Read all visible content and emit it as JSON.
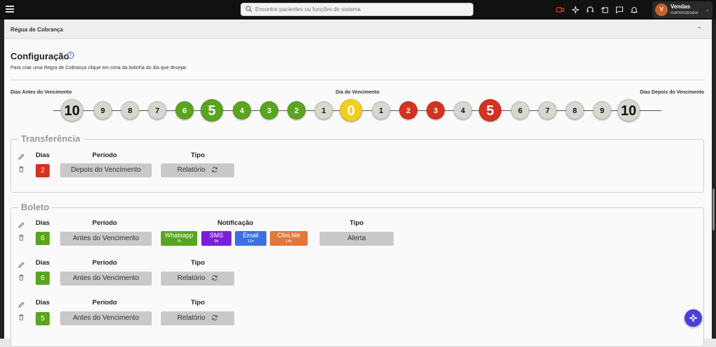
{
  "header": {
    "search_placeholder": "Encontre pacientes ou funções do sistema",
    "user_initial": "V",
    "user_name": "Vendas",
    "user_role": "Administrador"
  },
  "card": {
    "title": "Régua de Cobrança",
    "config_title": "Configuração",
    "config_desc": "Para criar uma Regra de Cobrança clique em cima da bolinha do dia que desejar.",
    "label_before": "Dias Antes do Vencimento",
    "label_due": "Dia do Vencimento",
    "label_after": "Dias Depois do Vencimento"
  },
  "timeline": [
    {
      "label": "10",
      "color": "gray",
      "size": "big"
    },
    {
      "label": "9",
      "color": "gray",
      "size": "small"
    },
    {
      "label": "8",
      "color": "gray",
      "size": "small"
    },
    {
      "label": "7",
      "color": "gray",
      "size": "small"
    },
    {
      "label": "6",
      "color": "green",
      "size": "small"
    },
    {
      "label": "5",
      "color": "green",
      "size": "big"
    },
    {
      "label": "4",
      "color": "green",
      "size": "small"
    },
    {
      "label": "3",
      "color": "green",
      "size": "small"
    },
    {
      "label": "2",
      "color": "green",
      "size": "small"
    },
    {
      "label": "1",
      "color": "gray",
      "size": "small"
    },
    {
      "label": "0",
      "color": "yellow",
      "size": "big"
    },
    {
      "label": "1",
      "color": "gray",
      "size": "small"
    },
    {
      "label": "2",
      "color": "red",
      "size": "small"
    },
    {
      "label": "3",
      "color": "red",
      "size": "small"
    },
    {
      "label": "4",
      "color": "gray",
      "size": "small"
    },
    {
      "label": "5",
      "color": "red",
      "size": "big"
    },
    {
      "label": "6",
      "color": "gray",
      "size": "small"
    },
    {
      "label": "7",
      "color": "gray",
      "size": "small"
    },
    {
      "label": "8",
      "color": "gray",
      "size": "small"
    },
    {
      "label": "9",
      "color": "gray",
      "size": "small"
    },
    {
      "label": "10",
      "color": "gray",
      "size": "big"
    }
  ],
  "transferencia": {
    "legend": "Transferência",
    "col_dias": "Dias",
    "col_periodo": "Período",
    "col_tipo": "Tipo",
    "dias": "2",
    "periodo": "Depois do Vencimento",
    "tipo": "Relatório"
  },
  "boleto": {
    "legend": "Boleto",
    "rows": [
      {
        "col_dias": "Dias",
        "col_periodo": "Período",
        "col_notificacao": "Notificação",
        "col_tipo": "Tipo",
        "dias": "6",
        "periodo": "Antes do Vencimento",
        "notifications": [
          {
            "name": "Whatsapp",
            "time": "7h"
          },
          {
            "name": "SMS",
            "time": "9h"
          },
          {
            "name": "Email",
            "time": "11h"
          },
          {
            "name": "Clini.Me",
            "time": "14h"
          }
        ],
        "tipo": "Alerta"
      },
      {
        "col_dias": "Dias",
        "col_periodo": "Período",
        "col_tipo": "Tipo",
        "dias": "6",
        "periodo": "Antes do Vencimento",
        "tipo": "Relatório"
      },
      {
        "col_dias": "Dias",
        "col_periodo": "Período",
        "col_tipo": "Tipo",
        "dias": "5",
        "periodo": "Antes do Vencimento",
        "tipo": "Relatório"
      }
    ]
  },
  "colors": {
    "green": "#5aa51f",
    "red": "#d6321f",
    "yellow": "#f5cd1c",
    "gray": "#d7d7cf",
    "whatsapp": "#5aa51f",
    "sms": "#7b1fd8",
    "email": "#3d6fe0",
    "clinime": "#e2783a",
    "fab": "#4a3fd8"
  }
}
